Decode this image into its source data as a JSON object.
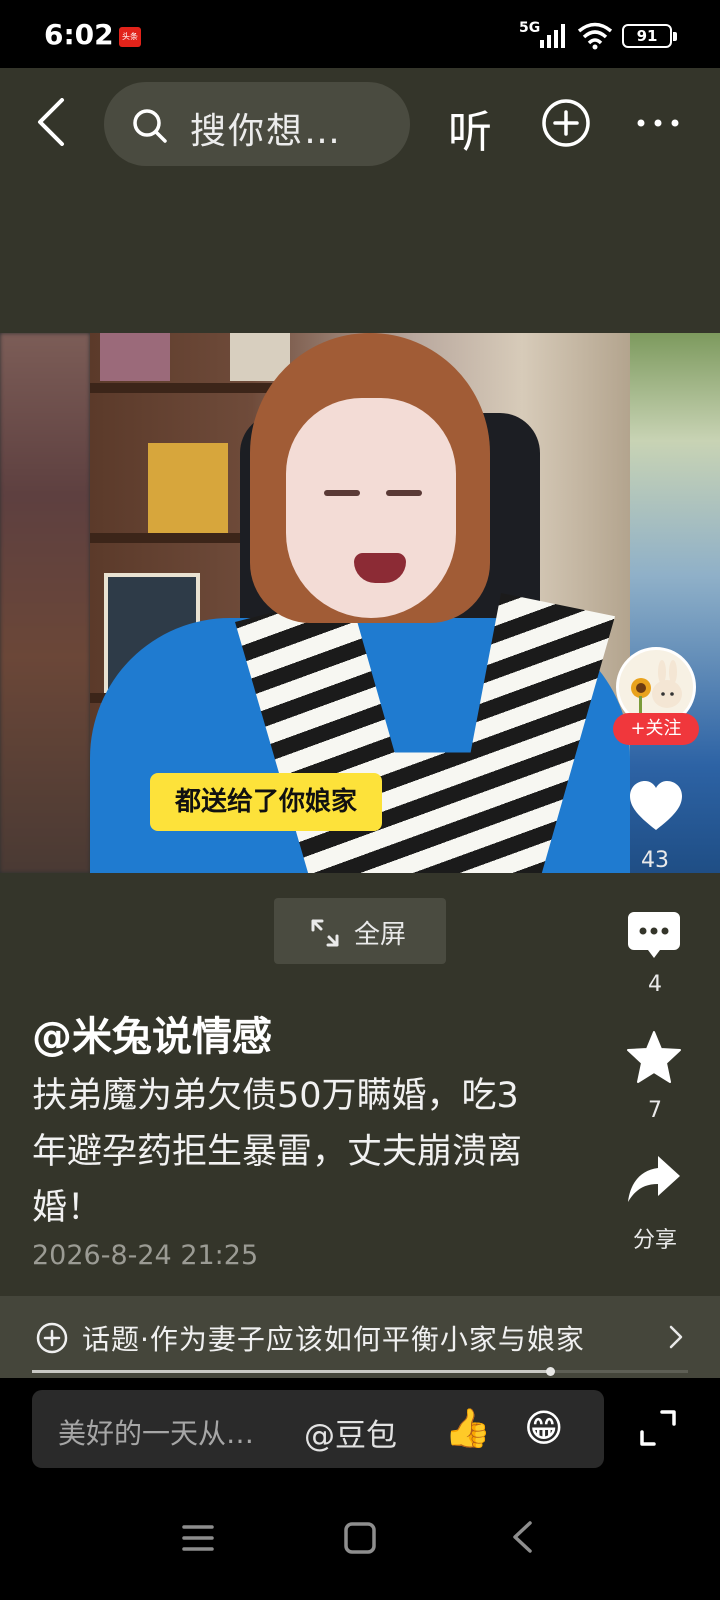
{
  "status_bar": {
    "time": "6:02",
    "app_badge": "头条",
    "network": "5G",
    "battery": "91"
  },
  "top_bar": {
    "search_placeholder": "搜你想…",
    "listen_label": "听"
  },
  "video": {
    "subtitle": "都送给了你娘家",
    "fullscreen_label": "全屏"
  },
  "actions": {
    "follow_label": "+关注",
    "like_count": "43",
    "comment_count": "4",
    "favorite_count": "7",
    "share_label": "分享"
  },
  "post": {
    "author": "@米兔说情感",
    "description": "扶弟魔为弟欠债50万瞒婚，吃3年避孕药拒生暴雷，丈夫崩溃离婚！",
    "date": "2026-8-24 21:25"
  },
  "topic": {
    "label": "话题·作为妻子应该如何平衡小家与娘家"
  },
  "playback": {
    "progress_fraction": 0.79
  },
  "comment_bar": {
    "placeholder": "美好的一天从…",
    "mention": "@豆包",
    "thumb_emoji": "👍",
    "grin_emoji": "😁"
  },
  "colors": {
    "background": "#34352a",
    "follow_red": "#f0373c",
    "subtitle_yellow": "#fde23a"
  }
}
